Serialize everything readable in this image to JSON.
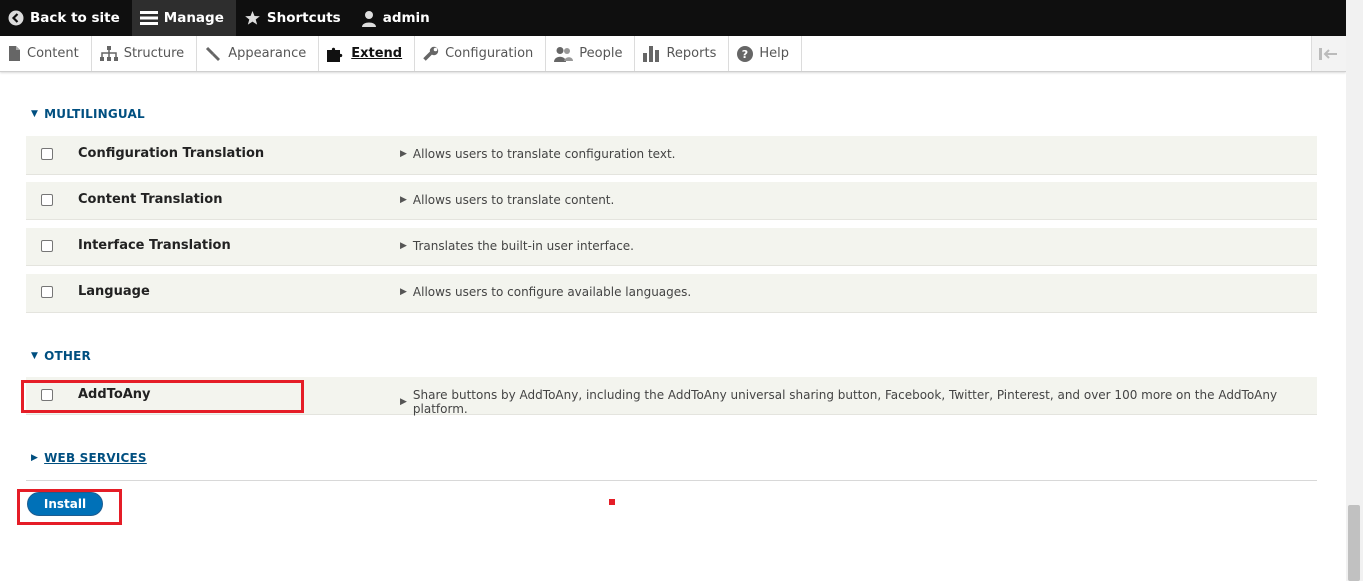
{
  "toolbar": {
    "back_to_site": "Back to site",
    "manage": "Manage",
    "shortcuts": "Shortcuts",
    "user": "admin"
  },
  "tray": {
    "items": [
      "Content",
      "Structure",
      "Appearance",
      "Extend",
      "Configuration",
      "People",
      "Reports",
      "Help"
    ],
    "active": "Extend"
  },
  "sections": {
    "multilingual": {
      "title": "MULTILINGUAL",
      "modules": [
        {
          "name": "Configuration Translation",
          "description": "Allows users to translate configuration text."
        },
        {
          "name": "Content Translation",
          "description": "Allows users to translate content."
        },
        {
          "name": "Interface Translation",
          "description": "Translates the built-in user interface."
        },
        {
          "name": "Language",
          "description": "Allows users to configure available languages."
        }
      ]
    },
    "other": {
      "title": "OTHER",
      "modules": [
        {
          "name": "AddToAny",
          "description": "Share buttons by AddToAny, including the AddToAny universal sharing button, Facebook, Twitter, Pinterest, and over 100 more on the AddToAny platform."
        }
      ]
    },
    "web_services": {
      "title": "WEB SERVICES"
    }
  },
  "actions": {
    "install_label": "Install"
  },
  "colors": {
    "accent": "#0071b8",
    "highlight": "#e51d27",
    "toolbar": "#0f0f0f",
    "section_link": "#004f80"
  }
}
